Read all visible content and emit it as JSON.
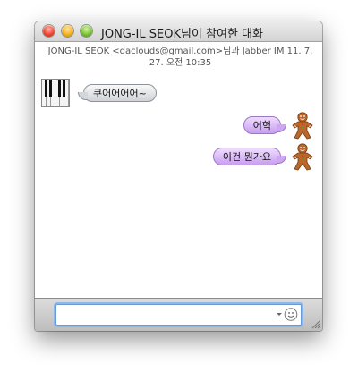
{
  "window": {
    "title": "JONG-IL SEOK님이 참여한 대화"
  },
  "chat": {
    "header": "JONG-IL SEOK <daclouds@gmail.com>님과 Jabber IM   11. 7. 27. 오전 10:35",
    "messages": [
      {
        "direction": "incoming",
        "text": "쿠어어어어~",
        "avatar": "piano-keys-avatar"
      },
      {
        "direction": "outgoing",
        "text": "어헉",
        "avatar": "gingerbread-man-avatar"
      },
      {
        "direction": "outgoing",
        "text": "이건 뭔가요",
        "avatar": "gingerbread-man-avatar"
      }
    ]
  },
  "compose": {
    "value": "",
    "placeholder": ""
  },
  "icons": {
    "emoticon": "smiley-icon",
    "dropdown": "chevron-down-icon",
    "resize": "resize-grip-icon"
  },
  "colors": {
    "incoming_bubble": "#d5d8dc",
    "outgoing_bubble": "#d3b0f5",
    "focus_ring": "#8fb7e8"
  }
}
